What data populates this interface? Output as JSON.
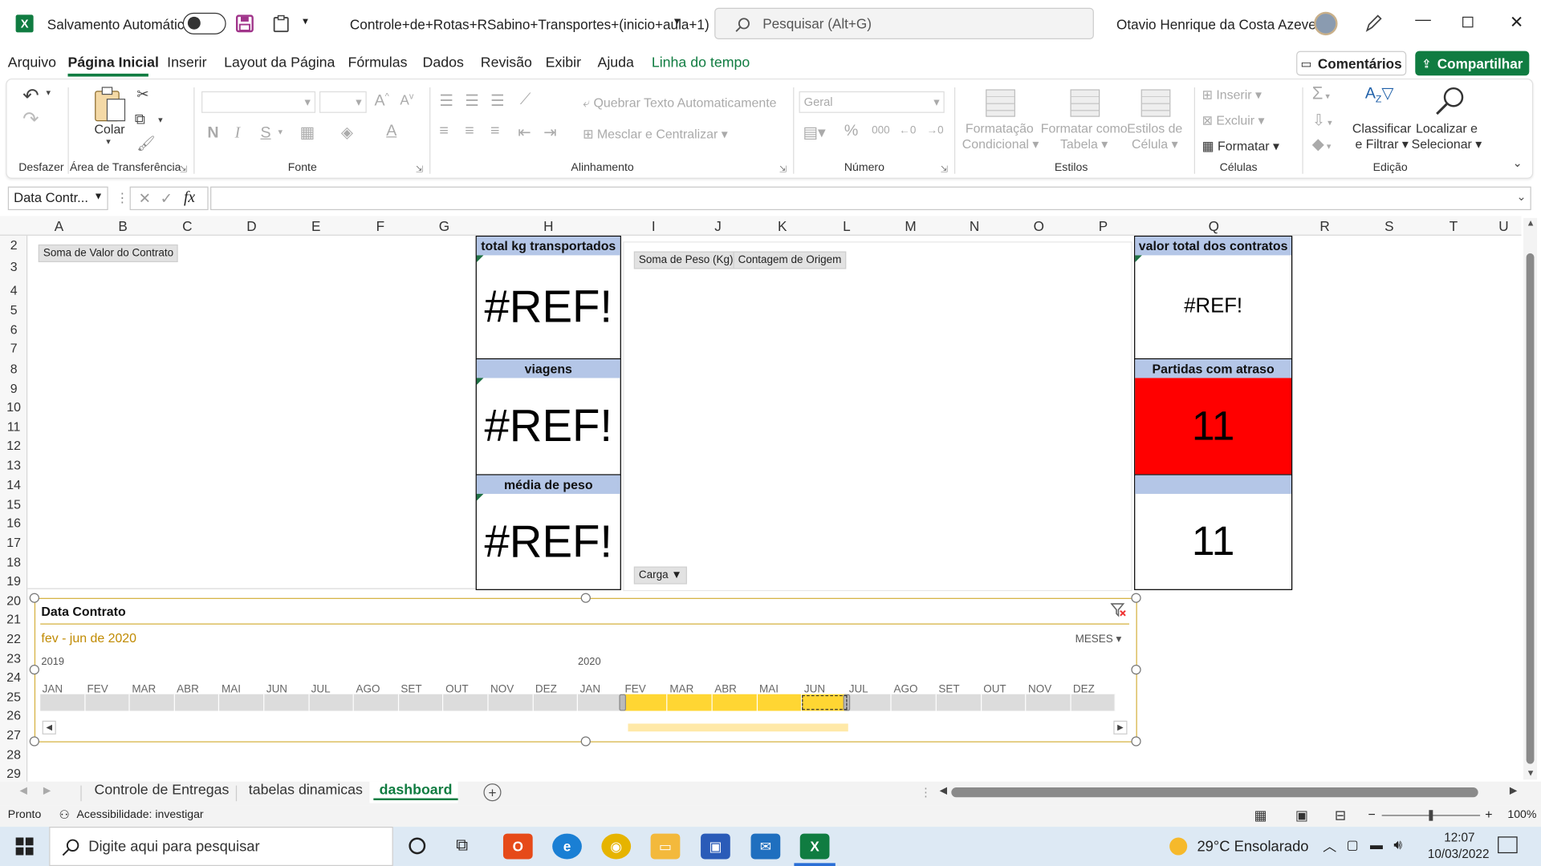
{
  "titlebar": {
    "autosave_label": "Salvamento Automático",
    "filename": "Controle+de+Rotas+RSabino+Transportes+(inicio+aula+1)",
    "search_placeholder": "Pesquisar (Alt+G)",
    "user": "Otavio Henrique da Costa Azevedo"
  },
  "menu": {
    "items": [
      "Arquivo",
      "Página Inicial",
      "Inserir",
      "Layout da Página",
      "Fórmulas",
      "Dados",
      "Revisão",
      "Exibir",
      "Ajuda",
      "Linha do tempo"
    ],
    "active": "Página Inicial",
    "comments": "Comentários",
    "share": "Compartilhar"
  },
  "ribbon": {
    "undo_group": "Desfazer",
    "clipboard": {
      "paste": "Colar",
      "group": "Área de Transferência"
    },
    "font": {
      "group": "Fonte",
      "bold": "N",
      "italic": "I",
      "underline": "S"
    },
    "alignment": {
      "wrap": "Quebrar Texto Automaticamente",
      "merge": "Mesclar e Centralizar",
      "group": "Alinhamento"
    },
    "number": {
      "format": "Geral",
      "group": "Número",
      "thousand": "000"
    },
    "styles": {
      "conditional": [
        "Formatação",
        "Condicional"
      ],
      "table": [
        "Formatar como",
        "Tabela"
      ],
      "cell": [
        "Estilos de",
        "Célula"
      ],
      "group": "Estilos"
    },
    "cells": {
      "insert": "Inserir",
      "delete": "Excluir",
      "format": "Formatar",
      "group": "Células"
    },
    "editing": {
      "sort": [
        "Classificar",
        "e Filtrar"
      ],
      "find": [
        "Localizar e",
        "Selecionar"
      ],
      "group": "Edição"
    }
  },
  "formula_bar": {
    "name_box": "Data Contr...",
    "fx": "fx",
    "value": ""
  },
  "grid": {
    "columns": [
      "A",
      "B",
      "C",
      "D",
      "E",
      "F",
      "G",
      "H",
      "I",
      "J",
      "K",
      "L",
      "M",
      "N",
      "O",
      "P",
      "Q",
      "R",
      "S",
      "T",
      "U"
    ],
    "rows": [
      "2",
      "3",
      "4",
      "5",
      "6",
      "7",
      "8",
      "9",
      "10",
      "11",
      "12",
      "13",
      "14",
      "15",
      "16",
      "17",
      "18",
      "19",
      "20",
      "21",
      "22",
      "23",
      "24",
      "25",
      "26",
      "27",
      "28",
      "29"
    ]
  },
  "pivots": {
    "valor_contrato": "Soma de Valor do Contrato",
    "peso": "Soma de Peso (Kg)",
    "origem": "Contagem  de Origem",
    "carga": "Carga"
  },
  "kpis": {
    "kg": {
      "label": "total kg transportados",
      "value": "#REF!"
    },
    "viagens": {
      "label": "viagens",
      "value": "#REF!"
    },
    "media": {
      "label": "média de peso",
      "value": "#REF!"
    },
    "valor": {
      "label": "valor total dos contratos",
      "value": "#REF!"
    },
    "atraso": {
      "label": "Partidas com atraso",
      "value": "11",
      "color": "#ff0000"
    },
    "extra": {
      "label": "",
      "value": "11"
    }
  },
  "timeline": {
    "title": "Data Contrato",
    "range": "fev - jun de 2020",
    "level": "MESES",
    "year1": "2019",
    "year2": "2020",
    "months": [
      "JAN",
      "FEV",
      "MAR",
      "ABR",
      "MAI",
      "JUN",
      "JUL",
      "AGO",
      "SET",
      "OUT",
      "NOV",
      "DEZ",
      "JAN",
      "FEV",
      "MAR",
      "ABR",
      "MAI",
      "JUN",
      "JUL",
      "AGO",
      "SET",
      "OUT",
      "NOV",
      "DEZ"
    ],
    "selected_from": 13,
    "selected_to": 17,
    "accent": "#d4b03c",
    "selection_color": "#ffd633"
  },
  "sheets": {
    "tabs": [
      "Controle de Entregas",
      "tabelas dinamicas",
      "dashboard"
    ],
    "active": "dashboard"
  },
  "status": {
    "ready": "Pronto",
    "accessibility": "Acessibilidade: investigar",
    "zoom": "100%"
  },
  "taskbar": {
    "search_placeholder": "Digite aqui para pesquisar",
    "weather": "29°C  Ensolarado",
    "time": "12:07",
    "date": "10/03/2022"
  }
}
